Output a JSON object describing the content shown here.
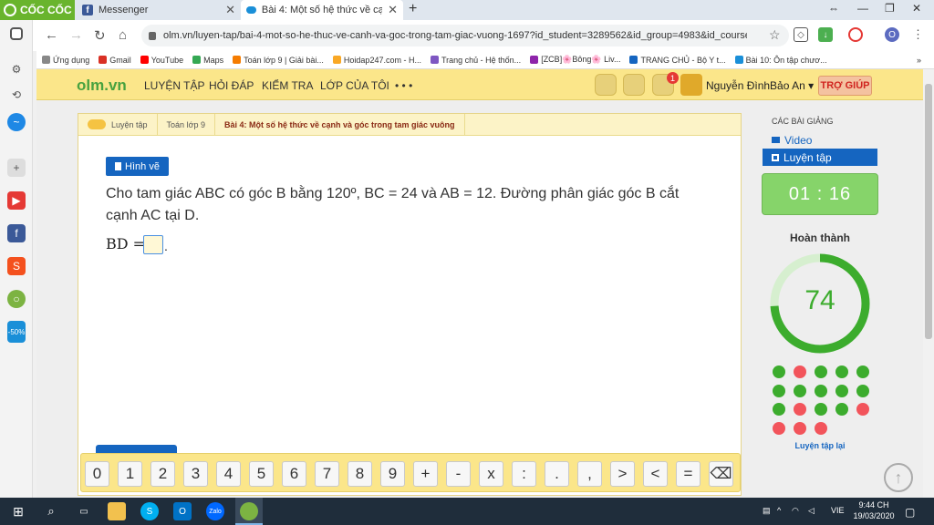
{
  "browser": {
    "brand": "CỐC CỐC",
    "tabs": [
      {
        "label": "Messenger"
      },
      {
        "label": "Bài 4: Một số hệ thức về cạnh"
      }
    ],
    "new_tab": "+",
    "url": "olm.vn/luyen-tap/bai-4-mot-so-he-thuc-ve-canh-va-goc-trong-tam-giac-vuong-1697?id_student=3289562&id_group=4983&id_coursewa...",
    "bookmarks": [
      "Ứng dụng",
      "Gmail",
      "YouTube",
      "Maps",
      "Toán lớp 9 | Giải bài...",
      "Hoidap247.com - H...",
      "Trang chủ - Hệ thốn...",
      "[ZCB]🌸Bông🌸 Liv...",
      "TRANG CHỦ - Bộ Y t...",
      "Bài 10: Ôn tập chươ..."
    ],
    "bookmark_more": "»"
  },
  "site": {
    "brand": "olm.vn",
    "menu": [
      "LUYỆN TẬP",
      "HỎI ĐÁP",
      "KIỂM TRA",
      "LỚP CỦA TÔI",
      "• • •"
    ],
    "notif_count": "1",
    "user": "Nguyễn ĐìnhBảo An ▾",
    "help": "TRỢ GIÚP"
  },
  "breadcrumb": [
    "Luyện tập",
    "Toán lớp 9",
    "Bài 4: Một số hệ thức về cạnh và góc trong tam giác vuông"
  ],
  "exercise": {
    "figure_button": "Hình vẽ",
    "question": "Cho tam giác ABC có góc B bằng 120º, BC = 24 và AB = 12. Đường phân giác góc B cắt cạnh AC tại D.",
    "answer_label": "BD =",
    "answer_value": "",
    "answer_suffix": "."
  },
  "keypad": [
    "0",
    "1",
    "2",
    "3",
    "4",
    "5",
    "6",
    "7",
    "8",
    "9",
    "+",
    "-",
    "x",
    ":",
    ".",
    ",",
    ">",
    "<",
    "=",
    "⌫"
  ],
  "panel": {
    "title": "CÁC BÀI GIẢNG",
    "video": "Video",
    "practice": "Luyện tập",
    "timer": "01 : 16",
    "done_label": "Hoàn thành",
    "score": "74",
    "score_fraction": 0.74,
    "results": [
      "green",
      "red",
      "green",
      "green",
      "green",
      "green",
      "green",
      "green",
      "green",
      "green",
      "green",
      "red",
      "green",
      "green",
      "red",
      "red",
      "red",
      "red"
    ],
    "retry": "Luyện tập lại",
    "colors": {
      "green": "#3cac2d",
      "red": "#f2545b",
      "accent": "#1565c0"
    }
  },
  "taskbar": {
    "lang": "VIE",
    "time": "9:44 CH",
    "date": "19/03/2020"
  }
}
